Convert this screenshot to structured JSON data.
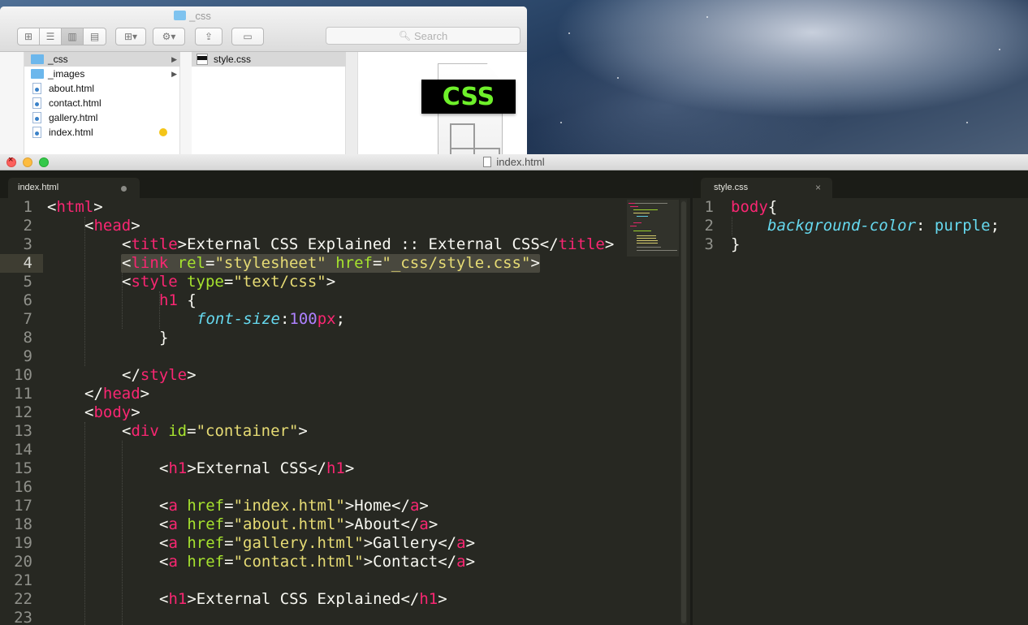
{
  "finder": {
    "title": "_css",
    "search_placeholder": "Search",
    "column1": [
      {
        "name": "_css",
        "type": "folder",
        "selected": true,
        "has_children": true
      },
      {
        "name": "_images",
        "type": "folder",
        "selected": false,
        "has_children": true
      },
      {
        "name": "about.html",
        "type": "html"
      },
      {
        "name": "contact.html",
        "type": "html"
      },
      {
        "name": "gallery.html",
        "type": "html"
      },
      {
        "name": "index.html",
        "type": "html",
        "tag_color": "#f4c518"
      }
    ],
    "column2": [
      {
        "name": "style.css",
        "type": "css",
        "selected": true
      }
    ],
    "preview_label": "CSS"
  },
  "editor": {
    "window_title": "index.html",
    "left_tab": {
      "label": "index.html",
      "modified": true
    },
    "right_tab": {
      "label": "style.css"
    },
    "left_lines": [
      "1",
      "2",
      "3",
      "4",
      "5",
      "6",
      "7",
      "8",
      "9",
      "10",
      "11",
      "12",
      "13",
      "14",
      "15",
      "16",
      "17",
      "18",
      "19",
      "20",
      "21",
      "22",
      "23"
    ],
    "right_lines": [
      "1",
      "2",
      "3"
    ],
    "current_line": 4,
    "theme_colors": {
      "background": "#272822",
      "tag": "#f92672",
      "attribute": "#a6e22e",
      "string": "#e6db74",
      "property": "#66d9ef",
      "number": "#ae81ff",
      "text": "#f8f8f2"
    },
    "left_code": {
      "l1": {
        "open": "<",
        "tag": "html",
        "close": ">"
      },
      "l2": {
        "open": "<",
        "tag": "head",
        "close": ">"
      },
      "l3": {
        "open": "<",
        "tag": "title",
        "mid": ">External CSS Explained :: External CSS</",
        "tag2": "title",
        "close": ">"
      },
      "l4": {
        "open": "<",
        "tag": "link",
        "attr1": "rel",
        "eq1": "=",
        "val1": "\"stylesheet\"",
        "attr2": "href",
        "eq2": "=",
        "val2": "\"_css/style.css\"",
        "close": ">"
      },
      "l5": {
        "open": "<",
        "tag": "style",
        "attr1": "type",
        "eq1": "=",
        "val1": "\"text/css\"",
        "close": ">"
      },
      "l6": {
        "selector": "h1",
        "brace": " {"
      },
      "l7": {
        "prop": "font-size",
        "colon": ":",
        "num": "100",
        "unit": "px",
        "semi": ";"
      },
      "l8": {
        "brace": "}"
      },
      "l10": {
        "open": "</",
        "tag": "style",
        "close": ">"
      },
      "l11": {
        "open": "</",
        "tag": "head",
        "close": ">"
      },
      "l12": {
        "open": "<",
        "tag": "body",
        "close": ">"
      },
      "l13": {
        "open": "<",
        "tag": "div",
        "attr1": "id",
        "eq1": "=",
        "val1": "\"container\"",
        "close": ">"
      },
      "l15": {
        "open": "<",
        "tag": "h1",
        "mid": ">External CSS</",
        "tag2": "h1",
        "close": ">"
      },
      "l17": {
        "open": "<",
        "tag": "a",
        "attr1": "href",
        "eq1": "=",
        "val1": "\"index.html\"",
        "mid": ">Home</",
        "tag2": "a",
        "close": ">"
      },
      "l18": {
        "open": "<",
        "tag": "a",
        "attr1": "href",
        "eq1": "=",
        "val1": "\"about.html\"",
        "mid": ">About</",
        "tag2": "a",
        "close": ">"
      },
      "l19": {
        "open": "<",
        "tag": "a",
        "attr1": "href",
        "eq1": "=",
        "val1": "\"gallery.html\"",
        "mid": ">Gallery</",
        "tag2": "a",
        "close": ">"
      },
      "l20": {
        "open": "<",
        "tag": "a",
        "attr1": "href",
        "eq1": "=",
        "val1": "\"contact.html\"",
        "mid": ">Contact</",
        "tag2": "a",
        "close": ">"
      },
      "l22": {
        "open": "<",
        "tag": "h1",
        "mid": ">External CSS Explained</",
        "tag2": "h1",
        "close": ">"
      }
    },
    "right_code": {
      "l1": {
        "selector": "body",
        "brace": "{"
      },
      "l2": {
        "prop": "background-color",
        "colon": ": ",
        "value": "purple",
        "semi": ";"
      },
      "l3": {
        "brace": "}"
      }
    }
  }
}
